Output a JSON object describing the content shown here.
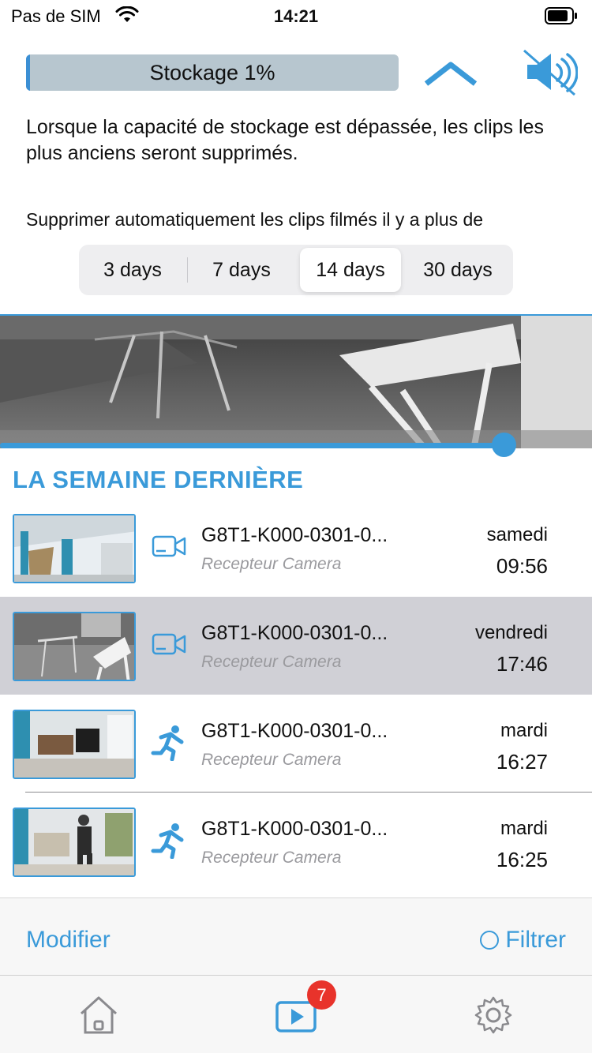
{
  "status_bar": {
    "carrier": "Pas de SIM",
    "time": "14:21"
  },
  "storage": {
    "label": "Stockage 1%",
    "percent": 1
  },
  "info": {
    "capacity_notice": "Lorsque la capacité de stockage est dépassée, les clips les plus anciens seront supprimés.",
    "auto_delete_label": "Supprimer automatiquement les clips filmés il y a plus de"
  },
  "retention": {
    "options": [
      "3 days",
      "7 days",
      "14 days",
      "30 days"
    ],
    "selected": "14 days"
  },
  "playback": {
    "progress": 0.85
  },
  "section": {
    "title": "LA SEMAINE DERNIÈRE"
  },
  "clips": [
    {
      "name": "G8T1-K000-0301-0...",
      "source": "Recepteur Camera",
      "day": "samedi",
      "time": "09:56",
      "type": "video-camera-icon",
      "selected": false
    },
    {
      "name": "G8T1-K000-0301-0...",
      "source": "Recepteur Camera",
      "day": "vendredi",
      "time": "17:46",
      "type": "video-camera-icon",
      "selected": true
    },
    {
      "name": "G8T1-K000-0301-0...",
      "source": "Recepteur Camera",
      "day": "mardi",
      "time": "16:27",
      "type": "motion-running-icon",
      "selected": false
    },
    {
      "name": "G8T1-K000-0301-0...",
      "source": "Recepteur Camera",
      "day": "mardi",
      "time": "16:25",
      "type": "motion-running-icon",
      "selected": false
    }
  ],
  "toolbar": {
    "modify_label": "Modifier",
    "filter_label": "Filtrer"
  },
  "tabbar": {
    "items": [
      "home-icon",
      "play-video-icon",
      "settings-gear-icon"
    ],
    "badge": "7"
  },
  "colors": {
    "accent": "#3a9ad9",
    "badge": "#e8332b",
    "selected_row": "#d0d0d6"
  }
}
